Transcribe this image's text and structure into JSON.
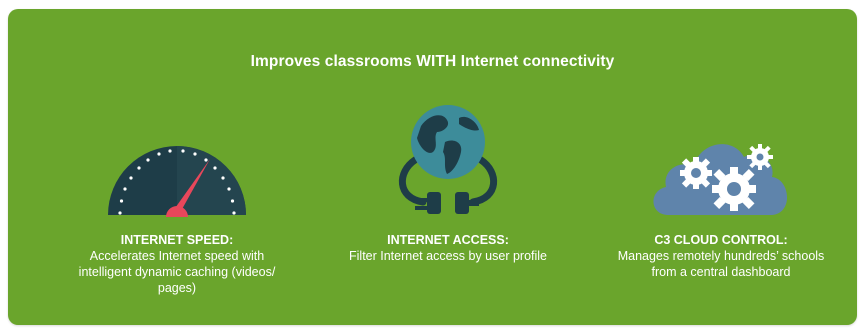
{
  "title": "Improves classrooms WITH Internet connectivity",
  "features": [
    {
      "heading": "INTERNET SPEED:",
      "description": "Accelerates Internet speed with intelligent dynamic caching (videos/ pages)",
      "icon": "speedometer-icon"
    },
    {
      "heading": "INTERNET ACCESS:",
      "description": "Filter Internet access by user profile",
      "icon": "globe-plug-icon"
    },
    {
      "heading": "C3 CLOUD CONTROL:",
      "description": "Manages remotely hundreds’ schools from a central dashboard",
      "icon": "cloud-gears-icon"
    }
  ],
  "colors": {
    "background": "#6aa52c",
    "text": "#ffffff",
    "gauge_dark": "#1f3f4a",
    "needle": "#e8475b",
    "globe": "#3d8c9a",
    "cloud": "#5f84ab"
  }
}
